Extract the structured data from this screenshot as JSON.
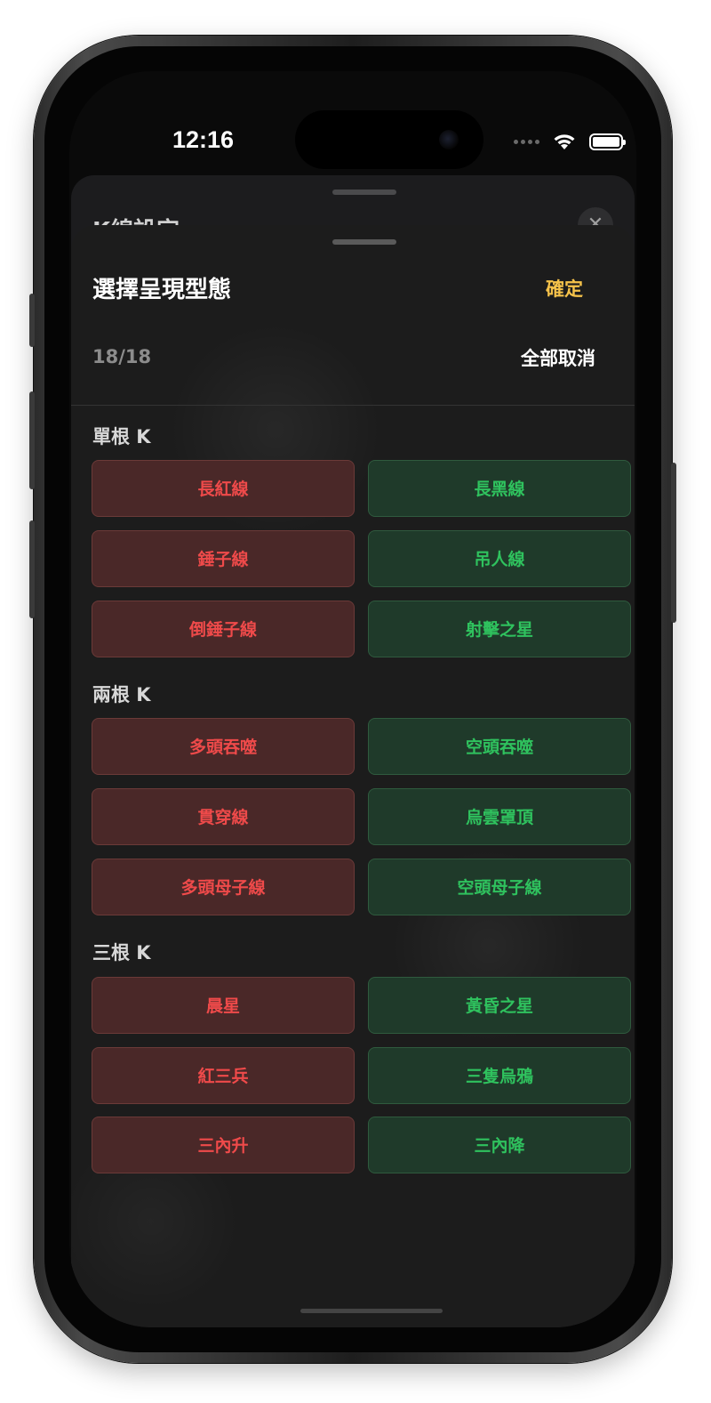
{
  "status_bar": {
    "time": "12:16"
  },
  "back_sheet": {
    "title": "K線設定",
    "close_icon": "✕"
  },
  "sheet": {
    "title": "選擇呈現型態",
    "confirm_label": "確定",
    "count": "18/18",
    "clear_all_label": "全部取消"
  },
  "sections": [
    {
      "label": "單根 K",
      "patterns": [
        {
          "bull": "長紅線",
          "bear": "長黑線"
        },
        {
          "bull": "錘子線",
          "bear": "吊人線"
        },
        {
          "bull": "倒錘子線",
          "bear": "射擊之星"
        }
      ]
    },
    {
      "label": "兩根 K",
      "patterns": [
        {
          "bull": "多頭吞噬",
          "bear": "空頭吞噬"
        },
        {
          "bull": "貫穿線",
          "bear": "烏雲罩頂"
        },
        {
          "bull": "多頭母子線",
          "bear": "空頭母子線"
        }
      ]
    },
    {
      "label": "三根 K",
      "patterns": [
        {
          "bull": "晨星",
          "bear": "黃昏之星"
        },
        {
          "bull": "紅三兵",
          "bear": "三隻烏鴉"
        },
        {
          "bull": "三內升",
          "bear": "三內降"
        }
      ]
    }
  ],
  "colors": {
    "bull_text": "#ef4a4a",
    "bear_text": "#2fc25e",
    "accent": "#f5c24a"
  },
  "icons": [
    "wifi-icon",
    "battery-icon",
    "signal-icon",
    "close-icon"
  ]
}
